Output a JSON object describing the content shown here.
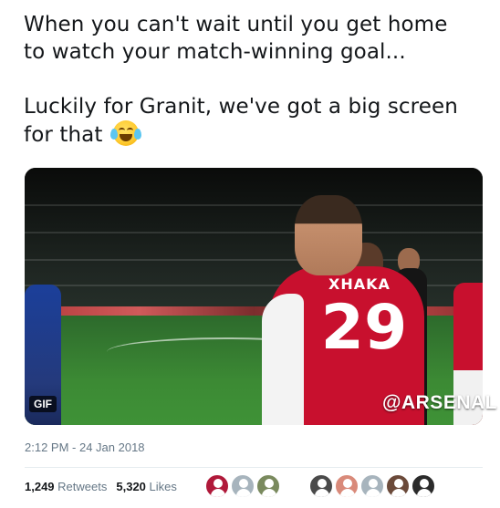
{
  "tweet": {
    "line1": "When you can't wait until you get home",
    "line2": "to watch your match-winning goal...",
    "line3": "Luckily for Granit, we've got a big screen",
    "line4": "for that"
  },
  "emoji_icon": "face-with-tears-of-joy",
  "media": {
    "badge": "GIF",
    "watermark": "@ARSENAL",
    "shirt_name": "XHAKA",
    "shirt_number": "29"
  },
  "timestamp": "2:12 PM - 24 Jan 2018",
  "stats": {
    "retweets_count": "1,249",
    "retweets_label": "Retweets",
    "likes_count": "5,320",
    "likes_label": "Likes"
  },
  "avatars": [
    {
      "color": "#b0193a"
    },
    {
      "color": "#a7b4bd"
    },
    {
      "color": "#7a8a5e"
    },
    {
      "color": "#4a4a4a"
    },
    {
      "color": "#d98a7a"
    },
    {
      "color": "#a7b4bd"
    },
    {
      "color": "#6b4a3a"
    },
    {
      "color": "#2b2b2b"
    }
  ]
}
